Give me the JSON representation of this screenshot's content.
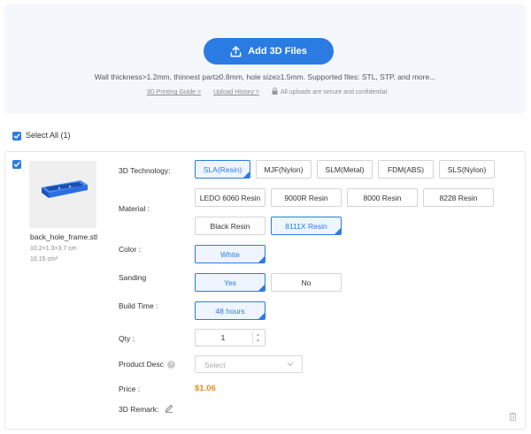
{
  "upload": {
    "add_button_label": "Add 3D Files",
    "hint": "Wall thickness>1.2mm, thinnest part≥0.8mm, hole size≥1.5mm. Supported files: STL, STP, and more...",
    "guide_link": "3D Printing Guide >",
    "history_link": "Upload History >",
    "secure_note": "All uploads are secure and confidential."
  },
  "select_all_label": "Select All (1)",
  "file": {
    "name": "back_hole_frame.stl",
    "dimensions": "10.2×1.3×3.7 cm",
    "volume": "10.15 cm³",
    "model_color": "#2a6fe0"
  },
  "labels": {
    "technology": "3D Technology:",
    "material": "Material :",
    "color": "Color :",
    "sanding": "Sanding",
    "build_time": "Build Time :",
    "qty": "Qty :",
    "product_desc": "Product Desc",
    "price": "Price :",
    "remark": "3D Remark:"
  },
  "technologies": [
    {
      "label": "SLA(Resin)",
      "selected": true
    },
    {
      "label": "MJF(Nylon)",
      "selected": false
    },
    {
      "label": "SLM(Metal)",
      "selected": false
    },
    {
      "label": "FDM(ABS)",
      "selected": false
    },
    {
      "label": "SLS(Nylon)",
      "selected": false
    }
  ],
  "materials": [
    {
      "label": "LEDO 6060 Resin",
      "selected": false
    },
    {
      "label": "9000R Resin",
      "selected": false
    },
    {
      "label": "8000 Resin",
      "selected": false
    },
    {
      "label": "8228 Resin",
      "selected": false
    },
    {
      "label": "Black Resin",
      "selected": false
    },
    {
      "label": "8111X Resin",
      "selected": true
    }
  ],
  "colors": [
    {
      "label": "White",
      "selected": true
    }
  ],
  "sanding": [
    {
      "label": "Yes",
      "selected": true
    },
    {
      "label": "No",
      "selected": false
    }
  ],
  "build_times": [
    {
      "label": "48 hours",
      "selected": true
    }
  ],
  "qty": "1",
  "product_desc_placeholder": "Select",
  "price": "$1.06",
  "accent_color": "#2a7ce3",
  "price_color": "#f08a24",
  "icons": [
    "upload-icon",
    "lock-icon",
    "check-icon",
    "help-icon",
    "chevron-down-icon",
    "pencil-icon",
    "trash-icon"
  ]
}
